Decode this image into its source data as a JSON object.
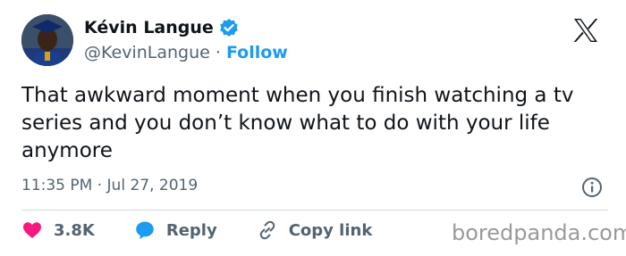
{
  "author": {
    "display_name": "Kévin Langue",
    "handle": "@KevinLangue",
    "separator": " · ",
    "follow_label": "Follow"
  },
  "tweet": {
    "text": "That awkward moment when you finish watching a tv series and you don’t know what to do with your life anymore",
    "timestamp": "11:35 PM · Jul 27, 2019"
  },
  "actions": {
    "likes": "3.8K",
    "reply_label": "Reply",
    "copy_link_label": "Copy link"
  },
  "watermark": "boredpanda.com",
  "colors": {
    "accent": "#1d9bf0",
    "like": "#f91880",
    "text": "#0f1419",
    "secondary": "#536471"
  },
  "icons": [
    "verified-badge-icon",
    "x-logo-icon",
    "info-icon",
    "heart-icon",
    "reply-bubble-icon",
    "link-icon"
  ]
}
